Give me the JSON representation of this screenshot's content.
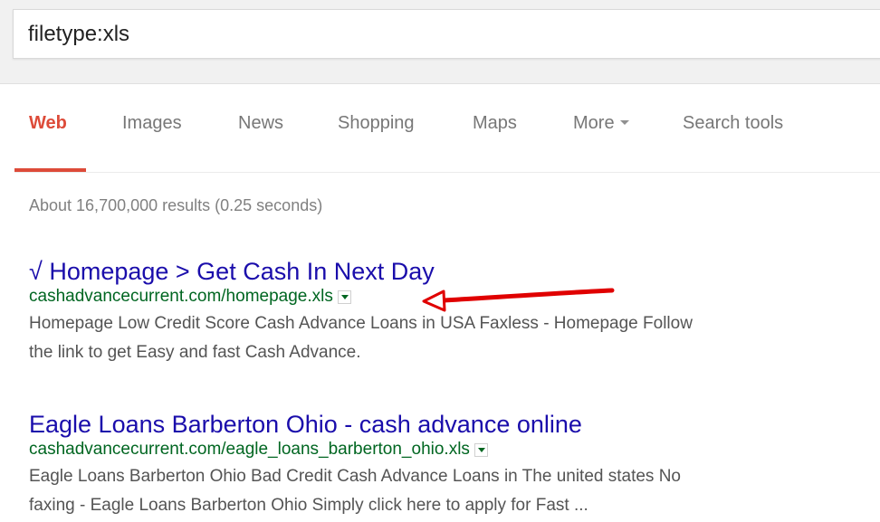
{
  "search": {
    "query": "filetype:xls"
  },
  "tabs": [
    {
      "label": "Web"
    },
    {
      "label": "Images"
    },
    {
      "label": "News"
    },
    {
      "label": "Shopping"
    },
    {
      "label": "Maps"
    },
    {
      "label": "More"
    },
    {
      "label": "Search tools"
    }
  ],
  "stats": "About 16,700,000 results (0.25 seconds)",
  "results": [
    {
      "title": "√ Homepage > Get Cash In Next Day",
      "url": "cashadvancecurrent.com/homepage.xls",
      "snippet_line1": "Homepage Low Credit Score Cash Advance Loans in USA Faxless - Homepage Follow",
      "snippet_line2": "the link to get Easy and fast Cash Advance."
    },
    {
      "title": "Eagle Loans Barberton Ohio - cash advance online",
      "url": "cashadvancecurrent.com/eagle_loans_barberton_ohio.xls",
      "snippet_line1": "Eagle Loans Barberton Ohio Bad Credit Cash Advance Loans in The united states No",
      "snippet_line2": "faxing - Eagle Loans Barberton Ohio Simply click here to apply for Fast ..."
    }
  ],
  "icons": {
    "url_dropdown": "chevron-down-icon",
    "more_caret": "caret-down-icon",
    "annotation": "red-arrow-icon"
  },
  "colors": {
    "active_tab": "#dd4b39",
    "result_title": "#1a0dab",
    "result_url": "#006621",
    "snippet": "#545454",
    "annotation_arrow": "#e00000"
  }
}
